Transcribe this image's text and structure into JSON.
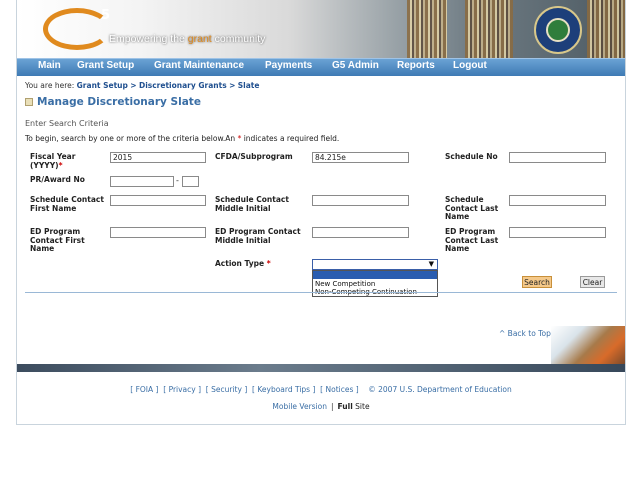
{
  "header": {
    "logo_text": "5",
    "tagline_pre": "Empowering the ",
    "tagline_highlight": "grant",
    "tagline_post": " community"
  },
  "nav": {
    "items": [
      "Main",
      "Grant Setup",
      "Grant Maintenance",
      "Payments",
      "G5 Admin",
      "Reports",
      "Logout"
    ]
  },
  "breadcrumb": {
    "prefix": "You are here:",
    "items": [
      "Grant Setup",
      "Discretionary Grants",
      "Slate"
    ],
    "separator": ">"
  },
  "page": {
    "title": "Manage Discretionary Slate",
    "section": "Enter Search Criteria",
    "instructions_pre": "To begin, search by one or more of the criteria below.An ",
    "instructions_star": "*",
    "instructions_post": " indicates a required field."
  },
  "form": {
    "fiscal_year": {
      "label": "Fiscal Year (YYYY)",
      "required": "*",
      "value": "2015"
    },
    "cfda": {
      "label": "CFDA/Subprogram",
      "value": "84.215e"
    },
    "schedule_no": {
      "label": "Schedule No",
      "value": ""
    },
    "pr_award": {
      "label": "PR/Award No",
      "value": "",
      "suffix": "",
      "dash": "-"
    },
    "sched_first": {
      "label": "Schedule Contact First Name",
      "value": ""
    },
    "sched_middle": {
      "label": "Schedule Contact Middle Initial",
      "value": ""
    },
    "sched_last": {
      "label": "Schedule Contact Last Name",
      "value": ""
    },
    "ed_first": {
      "label": "ED Program Contact First Name",
      "value": ""
    },
    "ed_middle": {
      "label": "ED Program Contact Middle Initial",
      "value": ""
    },
    "ed_last": {
      "label": "ED Program Contact Last Name",
      "value": ""
    },
    "action_type": {
      "label": "Action Type",
      "required": "*",
      "value": "",
      "arrow": "▼",
      "options": [
        "New Competition",
        "Non-Competing Continuation"
      ]
    },
    "search_label": "Search",
    "clear_label": "Clear"
  },
  "back_to_top": "^ Back to Top",
  "footer": {
    "links": [
      "FOIA",
      "Privacy",
      "Security",
      "Keyboard Tips",
      "Notices"
    ],
    "copyright": "©  2007  U.S.  Department  of  Education",
    "mobile": "Mobile  Version",
    "pipe": "|",
    "full": "Full",
    "site": "Site"
  },
  "colors": {
    "nav_bg": "#3e7ab4",
    "accent_orange": "#e08a1e",
    "link_blue": "#3a6ea5",
    "required_red": "#cc0000"
  }
}
